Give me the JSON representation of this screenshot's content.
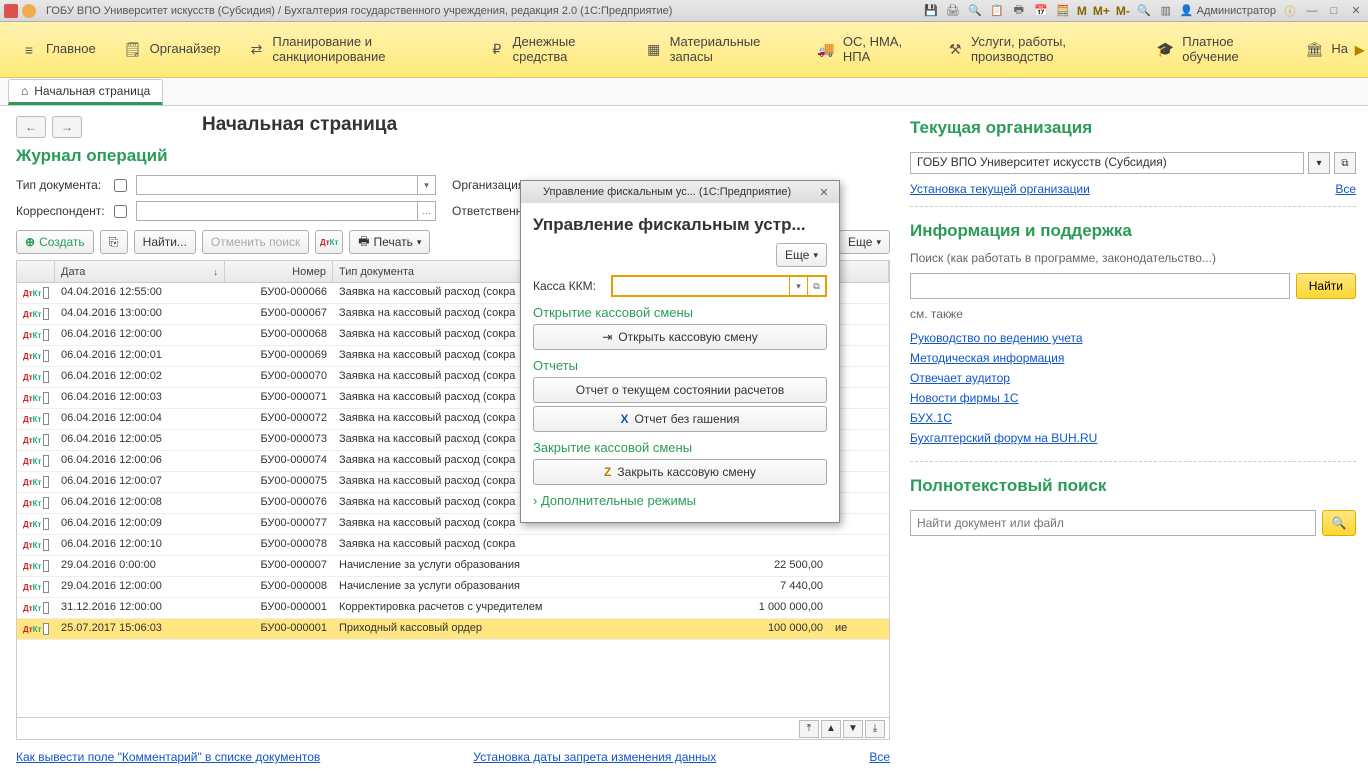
{
  "titlebar": {
    "title": "ГОБУ ВПО Университет искусств (Субсидия) / Бухгалтерия государственного учреждения, редакция 2.0  (1С:Предприятие)",
    "user": "Администратор"
  },
  "memory_btns": [
    "M",
    "M+",
    "M-"
  ],
  "menubar": [
    {
      "label": "Главное"
    },
    {
      "label": "Органайзер"
    },
    {
      "label": "Планирование и санкционирование"
    },
    {
      "label": "Денежные средства"
    },
    {
      "label": "Материальные запасы"
    },
    {
      "label": "ОС, НМА, НПА"
    },
    {
      "label": "Услуги, работы, производство"
    },
    {
      "label": "Платное обучение"
    },
    {
      "label": "На"
    }
  ],
  "start_tab": "Начальная страница",
  "page_title": "Начальная страница",
  "journal_title": "Журнал операций",
  "filters": {
    "doc_type_label": "Тип документа:",
    "org_label": "Организация",
    "corr_label": "Корреспондент:",
    "resp_label": "Ответственны"
  },
  "toolbar": {
    "create": "Создать",
    "find": "Найти...",
    "cancel_search": "Отменить поиск",
    "print": "Печать",
    "more": "Еще"
  },
  "columns": {
    "date": "Дата",
    "number": "Номер",
    "type": "Тип документа"
  },
  "rows": [
    {
      "date": "04.04.2016 12:55:00",
      "num": "БУ00-000066",
      "type": "Заявка на кассовый расход (сокра",
      "sum": ""
    },
    {
      "date": "04.04.2016 13:00:00",
      "num": "БУ00-000067",
      "type": "Заявка на кассовый расход (сокра",
      "sum": ""
    },
    {
      "date": "06.04.2016 12:00:00",
      "num": "БУ00-000068",
      "type": "Заявка на кассовый расход (сокра",
      "sum": ""
    },
    {
      "date": "06.04.2016 12:00:01",
      "num": "БУ00-000069",
      "type": "Заявка на кассовый расход (сокра",
      "sum": ""
    },
    {
      "date": "06.04.2016 12:00:02",
      "num": "БУ00-000070",
      "type": "Заявка на кассовый расход (сокра",
      "sum": ""
    },
    {
      "date": "06.04.2016 12:00:03",
      "num": "БУ00-000071",
      "type": "Заявка на кассовый расход (сокра",
      "sum": ""
    },
    {
      "date": "06.04.2016 12:00:04",
      "num": "БУ00-000072",
      "type": "Заявка на кассовый расход (сокра",
      "sum": ""
    },
    {
      "date": "06.04.2016 12:00:05",
      "num": "БУ00-000073",
      "type": "Заявка на кассовый расход (сокра",
      "sum": ""
    },
    {
      "date": "06.04.2016 12:00:06",
      "num": "БУ00-000074",
      "type": "Заявка на кассовый расход (сокра",
      "sum": ""
    },
    {
      "date": "06.04.2016 12:00:07",
      "num": "БУ00-000075",
      "type": "Заявка на кассовый расход (сокра",
      "sum": ""
    },
    {
      "date": "06.04.2016 12:00:08",
      "num": "БУ00-000076",
      "type": "Заявка на кассовый расход (сокра",
      "sum": ""
    },
    {
      "date": "06.04.2016 12:00:09",
      "num": "БУ00-000077",
      "type": "Заявка на кассовый расход (сокра",
      "sum": ""
    },
    {
      "date": "06.04.2016 12:00:10",
      "num": "БУ00-000078",
      "type": "Заявка на кассовый расход (сокра",
      "sum": ""
    },
    {
      "date": "29.04.2016 0:00:00",
      "num": "БУ00-000007",
      "type": "Начисление за услуги образования",
      "sum": "22 500,00"
    },
    {
      "date": "29.04.2016 12:00:00",
      "num": "БУ00-000008",
      "type": "Начисление за услуги образования",
      "sum": "7 440,00"
    },
    {
      "date": "31.12.2016 12:00:00",
      "num": "БУ00-000001",
      "type": "Корректировка расчетов с учредителем",
      "sum": "1 000 000,00"
    },
    {
      "date": "25.07.2017 15:06:03",
      "num": "БУ00-000001",
      "type": "Приходный кассовый ордер",
      "sum": "100 000,00",
      "sel": true
    }
  ],
  "bottom": {
    "link1": "Как вывести поле \"Комментарий\" в списке документов",
    "link2": "Установка даты запрета изменения данных",
    "all": "Все"
  },
  "modal": {
    "wintitle": "Управление фискальным ус...  (1С:Предприятие)",
    "heading": "Управление фискальным устр...",
    "more": "Еще",
    "kassa_label": "Касса ККМ:",
    "shift_open": "Открытие кассовой смены",
    "btn_open": "Открыть кассовую смену",
    "reports": "Отчеты",
    "btn_report_state": "Отчет о текущем состоянии расчетов",
    "btn_report_nog": "Отчет без гашения",
    "shift_close": "Закрытие кассовой смены",
    "btn_close": "Закрыть кассовую смену",
    "extra": "Дополнительные режимы"
  },
  "right": {
    "org_title": "Текущая организация",
    "org_value": "ГОБУ ВПО Университет искусств (Субсидия)",
    "org_link": "Установка текущей организации",
    "all": "Все",
    "info_title": "Информация и поддержка",
    "info_hint": "Поиск (как работать в программе, законодательство...)",
    "find": "Найти",
    "see_also": "см. также",
    "links": [
      "Руководство по ведению учета",
      "Методическая информация",
      "Отвечает аудитор",
      "Новости фирмы 1С",
      "БУХ.1С",
      "Бухгалтерский форум на BUH.RU"
    ],
    "fts_title": "Полнотекстовый поиск",
    "fts_placeholder": "Найти документ или файл"
  }
}
